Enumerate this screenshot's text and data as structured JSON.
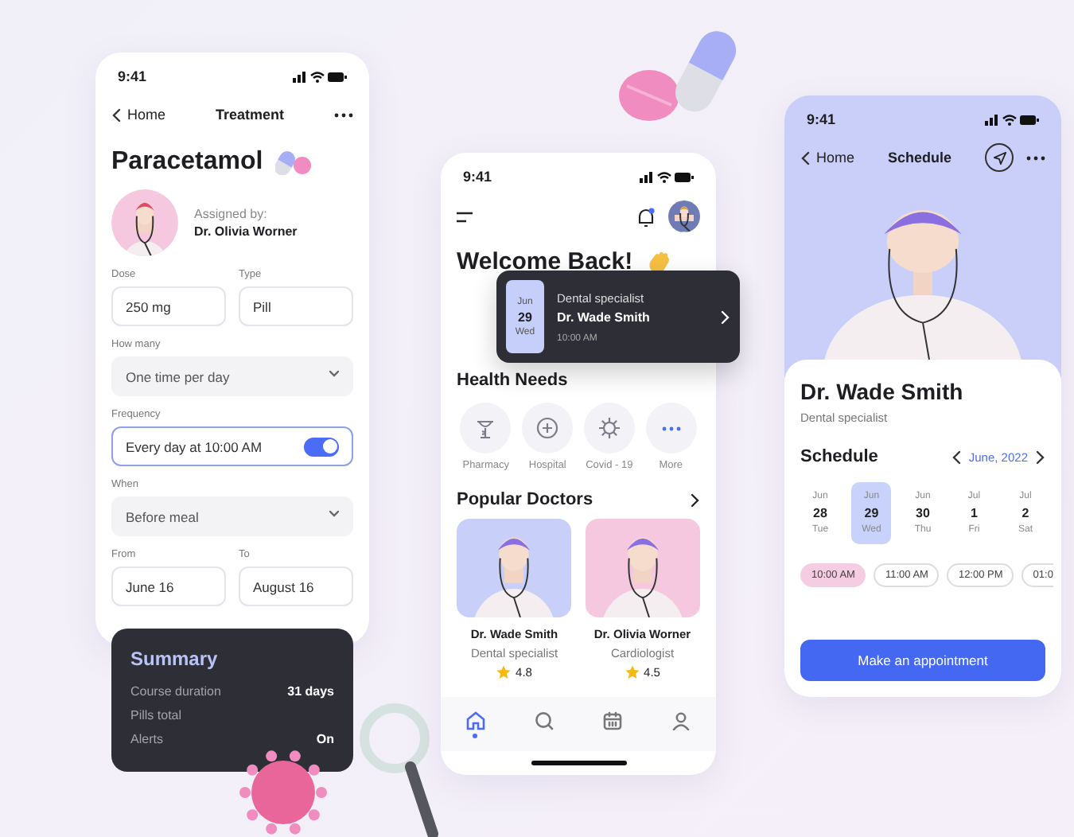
{
  "treatment": {
    "time": "9:41",
    "back": "Home",
    "title": "Treatment",
    "drug": "Paracetamol",
    "assigned_label": "Assigned by:",
    "doctor": "Dr. Olivia Worner",
    "field_rows": [
      [
        {
          "label": "Dose",
          "value": "250 mg",
          "kind": "input"
        },
        {
          "label": "Type",
          "value": "Pill",
          "kind": "input"
        }
      ],
      [
        {
          "label": "How many",
          "value": "One time per day",
          "kind": "select"
        }
      ],
      [
        {
          "label": "Frequency",
          "value": "Every day at 10:00 AM",
          "kind": "toggle",
          "on": true
        }
      ],
      [
        {
          "label": "When",
          "value": "Before meal",
          "kind": "select"
        }
      ],
      [
        {
          "label": "From",
          "value": "June 16",
          "kind": "input"
        },
        {
          "label": "To",
          "value": "August 16",
          "kind": "input"
        }
      ]
    ]
  },
  "summary": {
    "title": "Summary",
    "rows": [
      {
        "label": "Course duration",
        "value": "31 days"
      },
      {
        "label": "Pills total"
      },
      {
        "label": "Alerts",
        "value": "On"
      }
    ]
  },
  "home": {
    "time": "9:41",
    "greeting": "Welcome Back!",
    "appointment": {
      "month": "Jun",
      "day": "29",
      "weekday": "Wed",
      "specialty": "Dental specialist",
      "doctor": "Dr. Wade Smith",
      "time": "10:00 AM"
    },
    "health_title": "Health Needs",
    "categories": [
      {
        "label": "Pharmacy",
        "kind": "pharmacy"
      },
      {
        "label": "Hospital",
        "kind": "hospital"
      },
      {
        "label": "Covid - 19",
        "kind": "virus"
      },
      {
        "label": "More",
        "kind": "more"
      }
    ],
    "doctors_title": "Popular Doctors",
    "doctors": [
      {
        "name": "Dr. Wade Smith",
        "specialty": "Dental specialist",
        "rating": "4.8",
        "color": "#c8cff8"
      },
      {
        "name": "Dr. Olivia Worner",
        "specialty": "Cardiologist",
        "rating": "4.5",
        "color": "#f6c8df"
      }
    ],
    "nav": [
      {
        "kind": "home",
        "selected": true
      },
      {
        "kind": "search",
        "selected": false
      },
      {
        "kind": "calendar",
        "selected": false
      },
      {
        "kind": "profile",
        "selected": false
      }
    ]
  },
  "schedule": {
    "time": "9:41",
    "back": "Home",
    "title": "Schedule",
    "doctor": "Dr. Wade Smith",
    "specialty": "Dental specialist",
    "schedule_title": "Schedule",
    "month_label": "June, 2022",
    "days": [
      {
        "month": "Jun",
        "day": "28",
        "weekday": "Tue",
        "selected": false
      },
      {
        "month": "Jun",
        "day": "29",
        "weekday": "Wed",
        "selected": true
      },
      {
        "month": "Jun",
        "day": "30",
        "weekday": "Thu",
        "selected": false
      },
      {
        "month": "Jul",
        "day": "1",
        "weekday": "Fri",
        "selected": false
      },
      {
        "month": "Jul",
        "day": "2",
        "weekday": "Sat",
        "selected": false
      }
    ],
    "times": [
      {
        "label": "10:00 AM",
        "selected": true
      },
      {
        "label": "11:00 AM",
        "selected": false
      },
      {
        "label": "12:00 PM",
        "selected": false
      },
      {
        "label": "01:0",
        "selected": false
      }
    ],
    "button": "Make an appointment"
  }
}
